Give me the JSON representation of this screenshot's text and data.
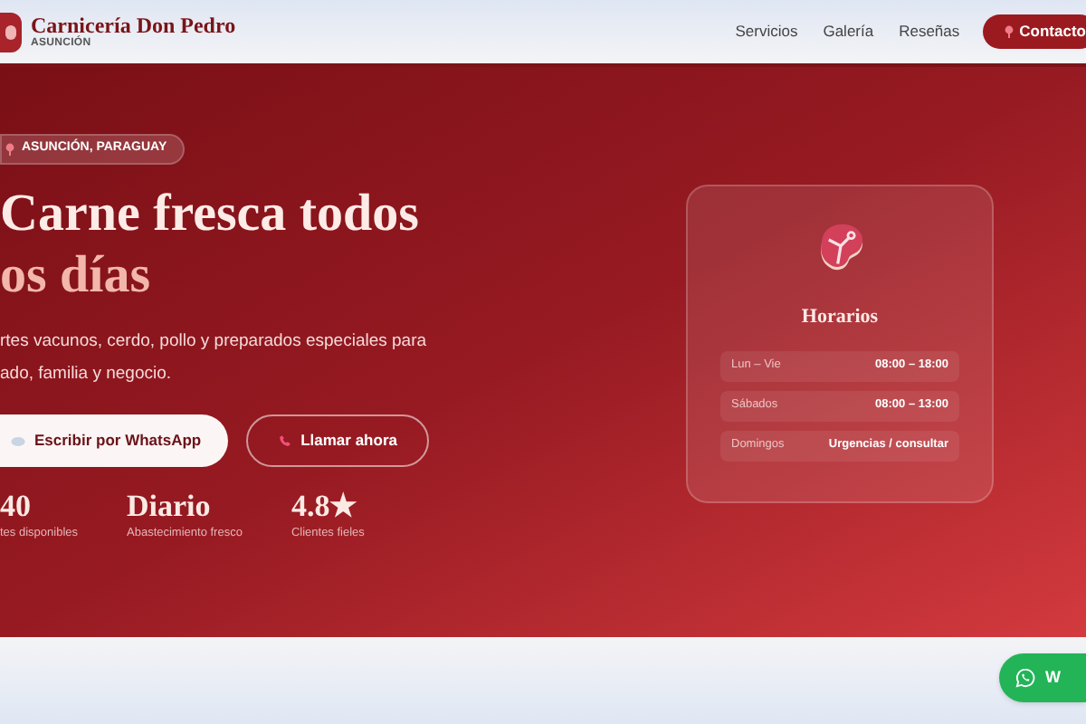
{
  "header": {
    "brand": "Carnicería Don Pedro",
    "subtitle": "ASUNCIÓN",
    "nav": [
      "Servicios",
      "Galería",
      "Reseñas"
    ],
    "cta": "Contacto"
  },
  "hero": {
    "badge": "ASUNCIÓN, PARAGUAY",
    "title_line_1": "Carne fresca todos",
    "title_line_2": "os días",
    "description": "rtes vacunos, cerdo, pollo y preparados especiales para",
    "description_2": "ado, familia y negocio.",
    "buttons": [
      {
        "kind": "primary",
        "label": "Escribir por WhatsApp"
      },
      {
        "kind": "outline",
        "label": "Llamar ahora"
      }
    ],
    "stats": [
      {
        "value": "40",
        "label": "tes disponibles"
      },
      {
        "value": "Diario",
        "label": "Abastecimiento fresco"
      },
      {
        "value": "4.8★",
        "label": "Clientes fieles"
      }
    ]
  },
  "hours": {
    "title": "Horarios",
    "rows": [
      {
        "day": "Lun – Vie",
        "time": "08:00 – 18:00"
      },
      {
        "day": "Sábados",
        "time": "08:00 – 13:00"
      },
      {
        "day": "Domingos",
        "time": "Urgencias / consultar"
      }
    ]
  },
  "whatsapp_float": {
    "label": "W"
  }
}
